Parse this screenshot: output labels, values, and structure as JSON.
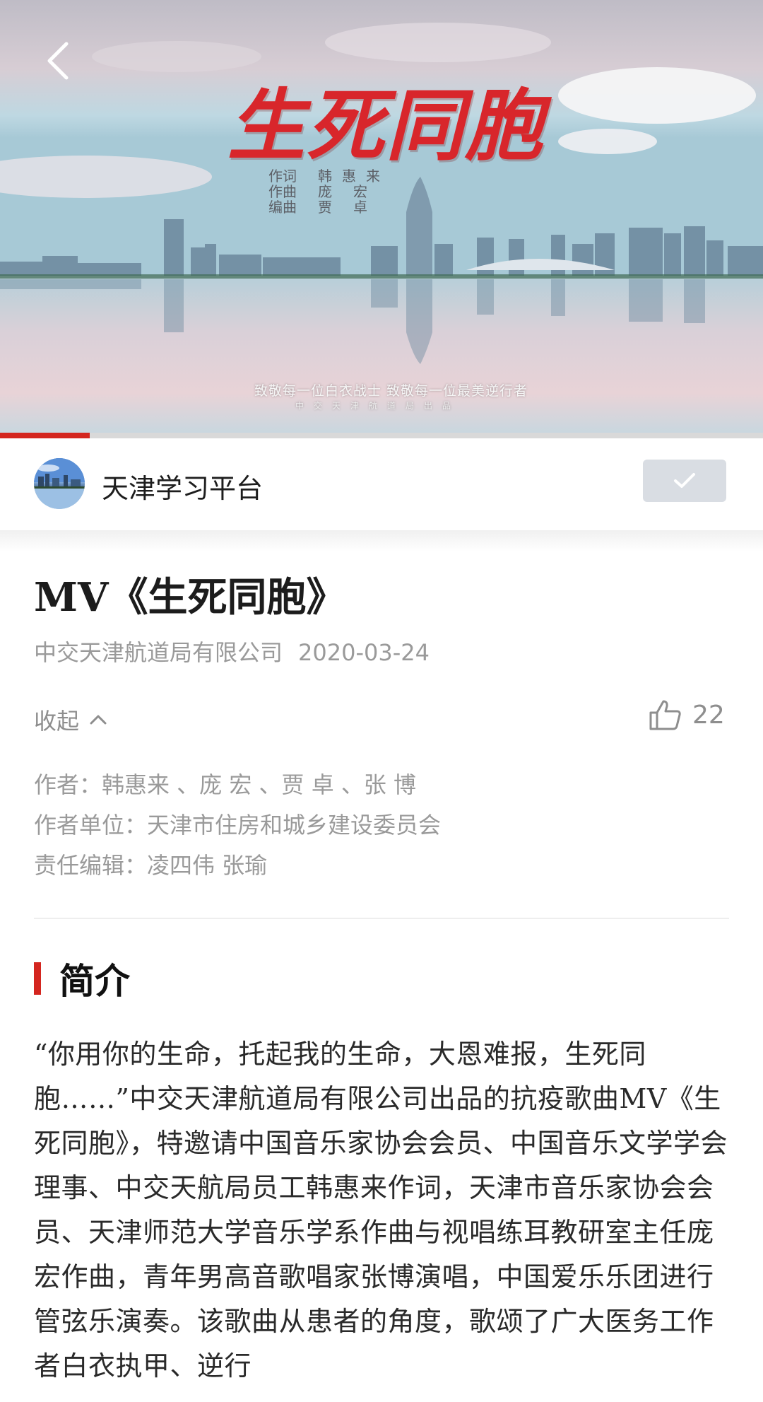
{
  "video": {
    "mv_title": "生死同胞",
    "credits": [
      {
        "role": "作词",
        "name": "韩惠来"
      },
      {
        "role": "作曲",
        "name": "庞宏"
      },
      {
        "role": "编曲",
        "name": "贾卓"
      }
    ],
    "tagline": "致敬每一位白衣战士 致敬每一位最美逆行者",
    "subtag": "中交天津航道局出品",
    "progress": 0.118
  },
  "channel": {
    "name": "天津学习平台",
    "follow_state": "followed"
  },
  "article": {
    "title": "MV《生死同胞》",
    "source": "中交天津航道局有限公司",
    "date": "2020-03-24",
    "collapse_label": "收起",
    "like_count": "22",
    "authors": "作者：韩惠来 、庞 宏 、贾 卓 、张 博",
    "author_unit": "作者单位：天津市住房和城乡建设委员会",
    "editor": "责任编辑：凌四伟 张瑜",
    "section_title": "简介",
    "intro": "“你用你的生命，托起我的生命，大恩难报，生死同胞……”中交天津航道局有限公司出品的抗疫歌曲MV《生死同胞》，特邀请中国音乐家协会会员、中国音乐文学学会理事、中交天航局员工韩惠来作词，天津市音乐家协会会员、天津师范大学音乐学系作曲与视唱练耳教研室主任庞宏作曲，青年男高音歌唱家张博演唱，中国爱乐乐团进行管弦乐演奏。该歌曲从患者的角度，歌颂了广大医务工作者白衣执甲、逆行"
  },
  "colors": {
    "accent": "#d4261f",
    "meta_text": "#9a9a9a",
    "follow_bg": "#d9dde3"
  }
}
